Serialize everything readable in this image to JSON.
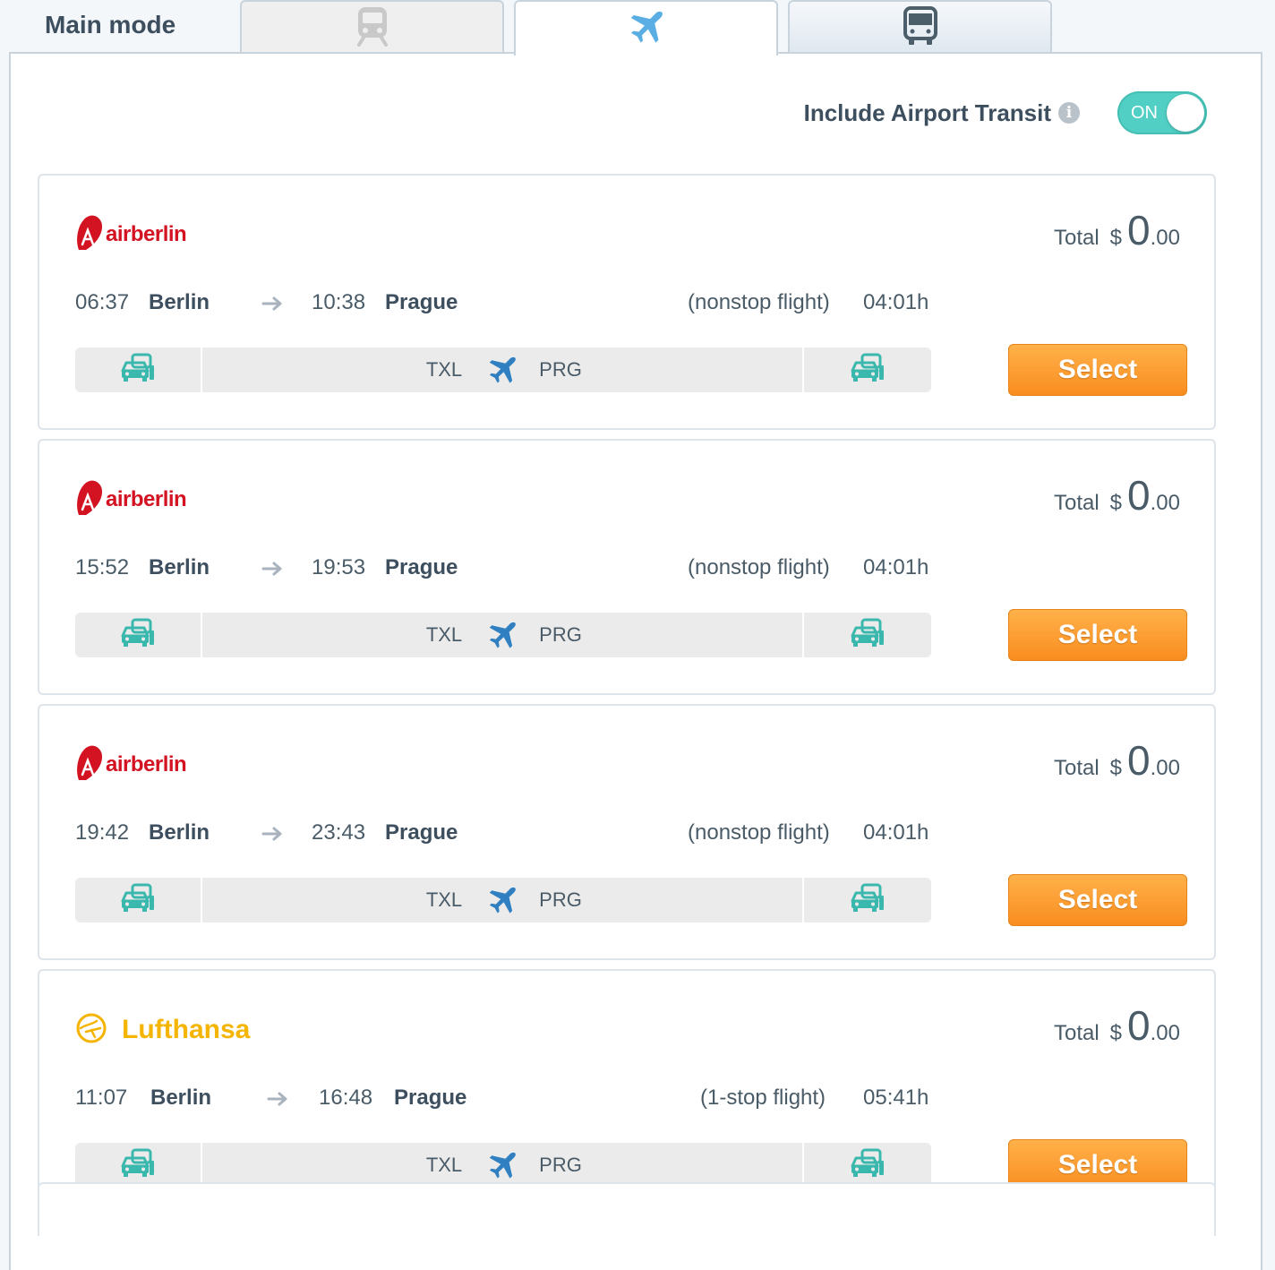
{
  "header": {
    "main_mode_label": "Main mode",
    "tabs": [
      {
        "name": "train",
        "icon": "train-icon",
        "active": false
      },
      {
        "name": "flight",
        "icon": "airplane-icon",
        "active": true
      },
      {
        "name": "bus",
        "icon": "bus-icon",
        "active": false
      }
    ]
  },
  "transit": {
    "label": "Include Airport Transit",
    "info_icon": "info-icon",
    "toggle_text": "ON",
    "toggle_on": true
  },
  "colors": {
    "accent_teal": "#52cfc4",
    "select_orange": "#f98d1f",
    "plane_blue": "#2f7fc1",
    "airberlin_red": "#d31222",
    "lufthansa_yellow": "#f4b400"
  },
  "results": [
    {
      "airline": "airberlin",
      "total_label": "Total",
      "currency": "$",
      "price_int": "0",
      "price_dec": ".00",
      "dep_time": "06:37",
      "origin": "Berlin",
      "arr_time": "10:38",
      "destination": "Prague",
      "stops": "(nonstop flight)",
      "duration": "04:01h",
      "from_code": "TXL",
      "to_code": "PRG",
      "select_label": "Select"
    },
    {
      "airline": "airberlin",
      "total_label": "Total",
      "currency": "$",
      "price_int": "0",
      "price_dec": ".00",
      "dep_time": "15:52",
      "origin": "Berlin",
      "arr_time": "19:53",
      "destination": "Prague",
      "stops": "(nonstop flight)",
      "duration": "04:01h",
      "from_code": "TXL",
      "to_code": "PRG",
      "select_label": "Select"
    },
    {
      "airline": "airberlin",
      "total_label": "Total",
      "currency": "$",
      "price_int": "0",
      "price_dec": ".00",
      "dep_time": "19:42",
      "origin": "Berlin",
      "arr_time": "23:43",
      "destination": "Prague",
      "stops": "(nonstop flight)",
      "duration": "04:01h",
      "from_code": "TXL",
      "to_code": "PRG",
      "select_label": "Select"
    },
    {
      "airline": "Lufthansa",
      "total_label": "Total",
      "currency": "$",
      "price_int": "0",
      "price_dec": ".00",
      "dep_time": "11:07",
      "origin": "Berlin",
      "arr_time": "16:48",
      "destination": "Prague",
      "stops": "(1-stop flight)",
      "duration": "05:41h",
      "from_code": "TXL",
      "to_code": "PRG",
      "select_label": "Select"
    }
  ]
}
